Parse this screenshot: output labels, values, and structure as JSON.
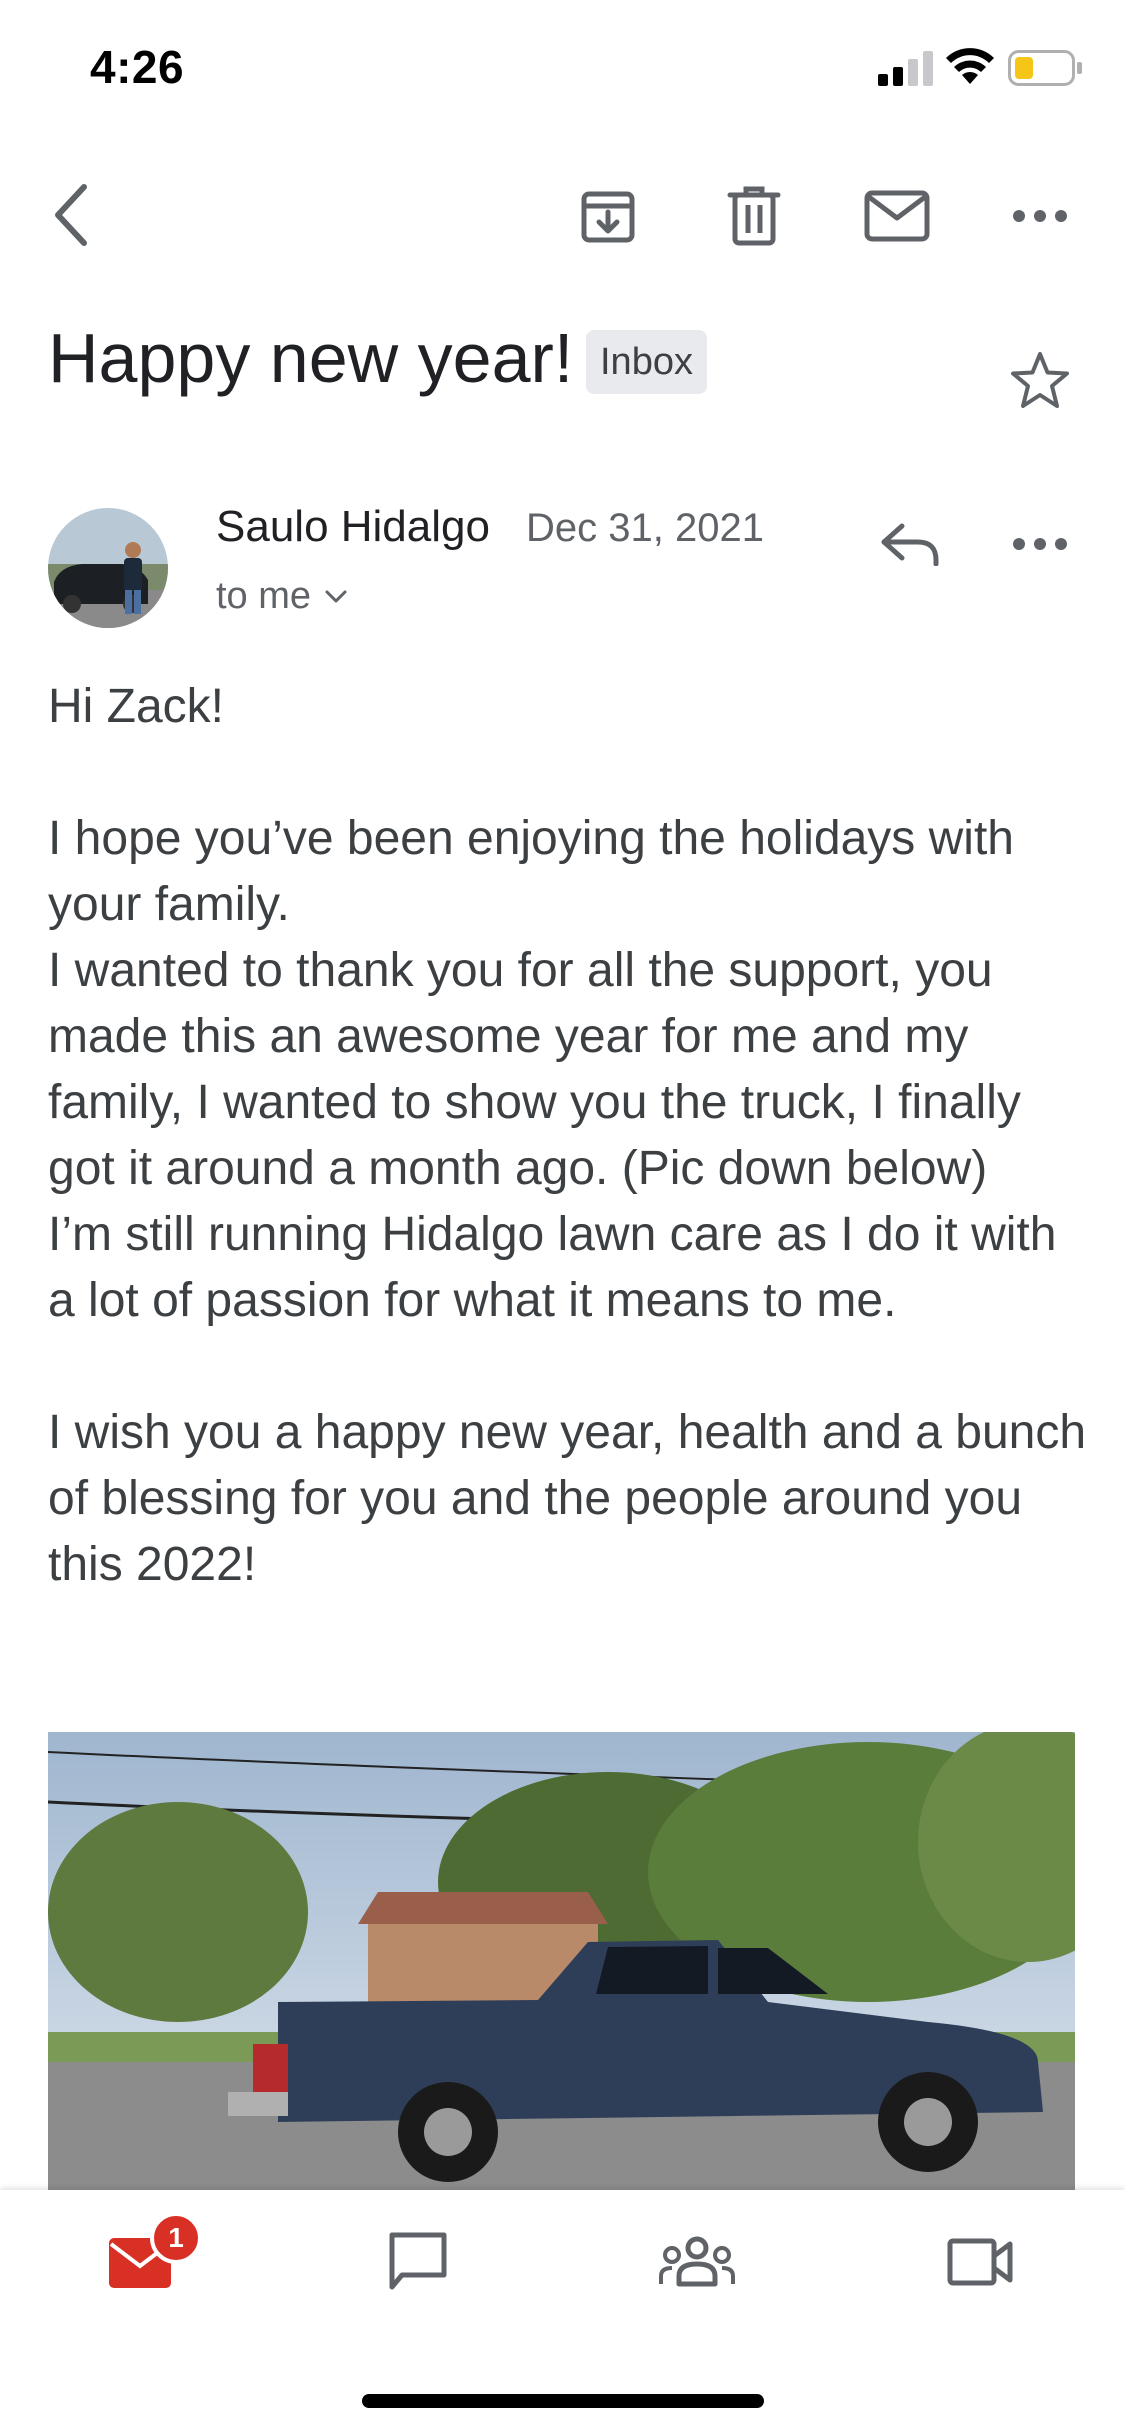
{
  "status_bar": {
    "time": "4:26"
  },
  "toolbar": {
    "icons": [
      "back-icon",
      "archive-icon",
      "delete-icon",
      "mark-unread-icon",
      "more-icon"
    ]
  },
  "email": {
    "subject": "Happy new year!",
    "label": "Inbox",
    "sender": "Saulo Hidalgo",
    "date": "Dec 31, 2021",
    "recipient": "to me",
    "body": "Hi Zack!\n\nI hope you’ve been enjoying the holidays with your family.\nI wanted to thank you for all the support, you made this an awesome year for me and my family, I wanted to show you the truck, I finally got it around a month ago. (Pic down below)\nI’m still running Hidalgo lawn care as I do it with a lot of passion for what it means to me.\n\nI wish you a happy new year, health and a bunch of blessing for you and the people around you this 2022!"
  },
  "bottom_nav": {
    "mail_badge": "1",
    "items": [
      "mail-icon",
      "chat-icon",
      "spaces-icon",
      "meet-icon"
    ]
  },
  "colors": {
    "accent_red": "#d93025",
    "icon_gray": "#5f6368"
  }
}
